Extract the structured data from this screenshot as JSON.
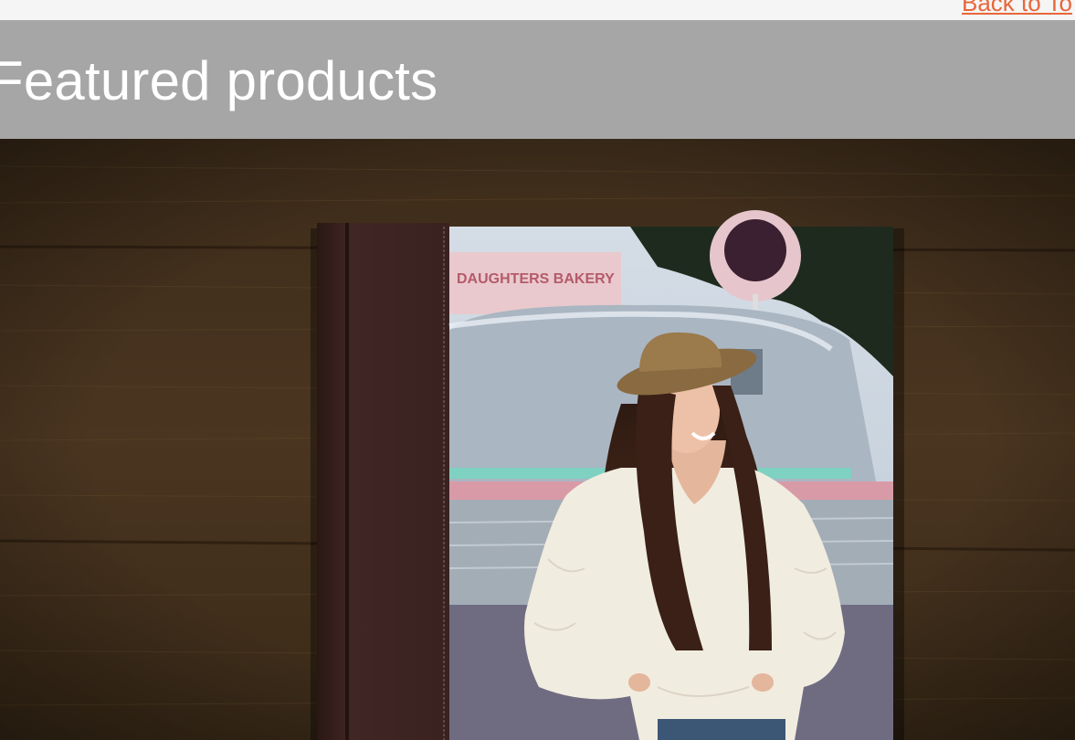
{
  "nav": {
    "back_link": "Back to To"
  },
  "banner": {
    "title": "Featured products"
  },
  "hero": {
    "photo_sign": "DAUGHTERS BAKERY",
    "colors": {
      "wood": "#4a3520",
      "leather": "#3a2320",
      "banner_bg": "#a6a6a6",
      "link": "#e8663a"
    }
  }
}
